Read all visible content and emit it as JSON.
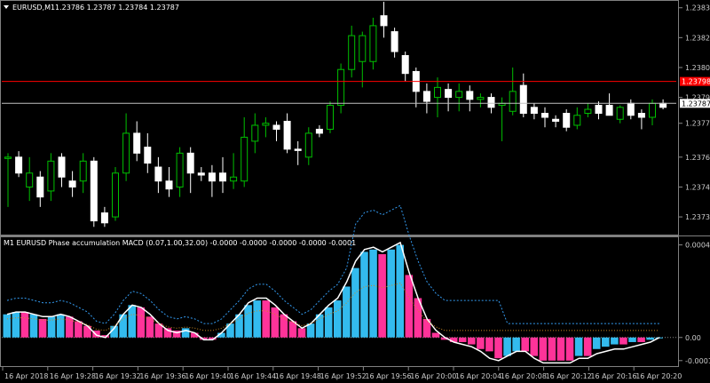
{
  "main_chart": {
    "symbol_header": "EURUSD,M1",
    "ohlc_header": "1.23786 1.23787 1.23784 1.23787",
    "price_ticks": [
      "1.23835",
      "1.23820",
      "1.23805",
      "1.23790",
      "1.23777",
      "1.23760",
      "1.23745",
      "1.23730"
    ],
    "red_line_label": "1.23798",
    "current_price_label": "1.23787",
    "colors": {
      "bull_stroke": "#00c000",
      "bull_fill": "#000000",
      "bear_fill": "#ffffff",
      "bear_stroke": "#ffffff",
      "red_line": "#ff0000",
      "price_line": "#c0c0c0",
      "grid": "#404040"
    }
  },
  "indicator": {
    "title": "M1 EURUSD Phase accumulation MACD (0.07,1.00,32.00) -0.0000 -0.0000 -0.0000 -0.0000 -0.0001",
    "y_ticks": [
      "0.0004",
      "0.00",
      "-0.0001"
    ],
    "colors": {
      "up": "#33bbee",
      "down": "#ff3399",
      "line": "#ffffff",
      "blue_dashed": "#3399ee",
      "orange_dotted": "#cc8822"
    }
  },
  "time_axis": {
    "labels": [
      "16 Apr 2018",
      "16 Apr 19:28",
      "16 Apr 19:32",
      "16 Apr 19:36",
      "16 Apr 19:40",
      "16 Apr 19:44",
      "16 Apr 19:48",
      "16 Apr 19:52",
      "16 Apr 19:56",
      "16 Apr 20:00",
      "16 Apr 20:04",
      "16 Apr 20:08",
      "16 Apr 20:12",
      "16 Apr 20:16",
      "16 Apr 20:20"
    ]
  },
  "chart_data": [
    {
      "type": "candlestick",
      "title": "EURUSD,M1",
      "ylim": [
        1.23722,
        1.23838
      ],
      "candles": [
        {
          "o": 1.2376,
          "h": 1.23762,
          "l": 1.23735,
          "c": 1.2376,
          "bull": true
        },
        {
          "o": 1.2376,
          "h": 1.23763,
          "l": 1.2375,
          "c": 1.23752,
          "bull": false
        },
        {
          "o": 1.23745,
          "h": 1.2376,
          "l": 1.23738,
          "c": 1.23752,
          "bull": true
        },
        {
          "o": 1.2375,
          "h": 1.23753,
          "l": 1.23735,
          "c": 1.2374,
          "bull": false
        },
        {
          "o": 1.23743,
          "h": 1.23762,
          "l": 1.23738,
          "c": 1.23758,
          "bull": true
        },
        {
          "o": 1.2376,
          "h": 1.23762,
          "l": 1.23745,
          "c": 1.2375,
          "bull": false
        },
        {
          "o": 1.23748,
          "h": 1.23753,
          "l": 1.2374,
          "c": 1.23745,
          "bull": false
        },
        {
          "o": 1.23748,
          "h": 1.23762,
          "l": 1.23742,
          "c": 1.23758,
          "bull": true
        },
        {
          "o": 1.23758,
          "h": 1.2376,
          "l": 1.23725,
          "c": 1.23728,
          "bull": false
        },
        {
          "o": 1.23727,
          "h": 1.23735,
          "l": 1.23725,
          "c": 1.23732,
          "bull": false
        },
        {
          "o": 1.2373,
          "h": 1.23755,
          "l": 1.23728,
          "c": 1.23752,
          "bull": true
        },
        {
          "o": 1.23752,
          "h": 1.23782,
          "l": 1.23748,
          "c": 1.23772,
          "bull": true
        },
        {
          "o": 1.23772,
          "h": 1.23778,
          "l": 1.23758,
          "c": 1.23762,
          "bull": false
        },
        {
          "o": 1.23765,
          "h": 1.23772,
          "l": 1.23752,
          "c": 1.23757,
          "bull": false
        },
        {
          "o": 1.23755,
          "h": 1.2376,
          "l": 1.23742,
          "c": 1.23748,
          "bull": false
        },
        {
          "o": 1.23748,
          "h": 1.23755,
          "l": 1.2374,
          "c": 1.23744,
          "bull": false
        },
        {
          "o": 1.23745,
          "h": 1.23765,
          "l": 1.2374,
          "c": 1.23762,
          "bull": true
        },
        {
          "o": 1.23762,
          "h": 1.23765,
          "l": 1.23742,
          "c": 1.23752,
          "bull": false
        },
        {
          "o": 1.23752,
          "h": 1.23755,
          "l": 1.23748,
          "c": 1.23751,
          "bull": false
        },
        {
          "o": 1.23752,
          "h": 1.23756,
          "l": 1.2374,
          "c": 1.23748,
          "bull": false
        },
        {
          "o": 1.23748,
          "h": 1.2376,
          "l": 1.23742,
          "c": 1.23752,
          "bull": false
        },
        {
          "o": 1.2375,
          "h": 1.23762,
          "l": 1.23744,
          "c": 1.23748,
          "bull": true
        },
        {
          "o": 1.23748,
          "h": 1.2378,
          "l": 1.23745,
          "c": 1.2377,
          "bull": true
        },
        {
          "o": 1.23768,
          "h": 1.23782,
          "l": 1.23762,
          "c": 1.23776,
          "bull": true
        },
        {
          "o": 1.23776,
          "h": 1.2378,
          "l": 1.2377,
          "c": 1.23777,
          "bull": true
        },
        {
          "o": 1.23776,
          "h": 1.23778,
          "l": 1.23768,
          "c": 1.23774,
          "bull": false
        },
        {
          "o": 1.23778,
          "h": 1.23782,
          "l": 1.23762,
          "c": 1.23764,
          "bull": false
        },
        {
          "o": 1.23764,
          "h": 1.23768,
          "l": 1.23756,
          "c": 1.23764,
          "bull": false
        },
        {
          "o": 1.2376,
          "h": 1.23775,
          "l": 1.23756,
          "c": 1.23772,
          "bull": true
        },
        {
          "o": 1.23772,
          "h": 1.23776,
          "l": 1.2377,
          "c": 1.23774,
          "bull": false
        },
        {
          "o": 1.23774,
          "h": 1.23788,
          "l": 1.23772,
          "c": 1.23786,
          "bull": true
        },
        {
          "o": 1.23786,
          "h": 1.23807,
          "l": 1.23782,
          "c": 1.23804,
          "bull": true
        },
        {
          "o": 1.23804,
          "h": 1.23826,
          "l": 1.238,
          "c": 1.23821,
          "bull": true
        },
        {
          "o": 1.23821,
          "h": 1.23823,
          "l": 1.23795,
          "c": 1.23808,
          "bull": true
        },
        {
          "o": 1.23808,
          "h": 1.2383,
          "l": 1.23804,
          "c": 1.23826,
          "bull": true
        },
        {
          "o": 1.23826,
          "h": 1.23838,
          "l": 1.2382,
          "c": 1.23831,
          "bull": false
        },
        {
          "o": 1.23823,
          "h": 1.23825,
          "l": 1.2381,
          "c": 1.23813,
          "bull": false
        },
        {
          "o": 1.23811,
          "h": 1.23813,
          "l": 1.23798,
          "c": 1.23802,
          "bull": false
        },
        {
          "o": 1.23803,
          "h": 1.23805,
          "l": 1.23785,
          "c": 1.23793,
          "bull": false
        },
        {
          "o": 1.23793,
          "h": 1.23797,
          "l": 1.23782,
          "c": 1.23788,
          "bull": false
        },
        {
          "o": 1.2379,
          "h": 1.238,
          "l": 1.2378,
          "c": 1.23795,
          "bull": true
        },
        {
          "o": 1.23794,
          "h": 1.23797,
          "l": 1.23783,
          "c": 1.2379,
          "bull": false
        },
        {
          "o": 1.2379,
          "h": 1.23797,
          "l": 1.23783,
          "c": 1.23793,
          "bull": true
        },
        {
          "o": 1.23793,
          "h": 1.23796,
          "l": 1.23783,
          "c": 1.23789,
          "bull": false
        },
        {
          "o": 1.23789,
          "h": 1.23792,
          "l": 1.23785,
          "c": 1.2379,
          "bull": true
        },
        {
          "o": 1.2379,
          "h": 1.23792,
          "l": 1.23782,
          "c": 1.23785,
          "bull": false
        },
        {
          "o": 1.23786,
          "h": 1.2379,
          "l": 1.23768,
          "c": 1.23787,
          "bull": true
        },
        {
          "o": 1.23783,
          "h": 1.23805,
          "l": 1.23781,
          "c": 1.23793,
          "bull": true
        },
        {
          "o": 1.23796,
          "h": 1.23802,
          "l": 1.2378,
          "c": 1.23782,
          "bull": false
        },
        {
          "o": 1.23785,
          "h": 1.23787,
          "l": 1.23779,
          "c": 1.23782,
          "bull": false
        },
        {
          "o": 1.23782,
          "h": 1.23785,
          "l": 1.23775,
          "c": 1.2378,
          "bull": false
        },
        {
          "o": 1.23779,
          "h": 1.23781,
          "l": 1.23775,
          "c": 1.23778,
          "bull": false
        },
        {
          "o": 1.23782,
          "h": 1.23784,
          "l": 1.23773,
          "c": 1.23775,
          "bull": false
        },
        {
          "o": 1.23776,
          "h": 1.23785,
          "l": 1.23774,
          "c": 1.23781,
          "bull": true
        },
        {
          "o": 1.23782,
          "h": 1.23787,
          "l": 1.2378,
          "c": 1.23784,
          "bull": true
        },
        {
          "o": 1.23782,
          "h": 1.23788,
          "l": 1.23779,
          "c": 1.23786,
          "bull": false
        },
        {
          "o": 1.23786,
          "h": 1.23792,
          "l": 1.23782,
          "c": 1.23781,
          "bull": false
        },
        {
          "o": 1.23779,
          "h": 1.23786,
          "l": 1.23777,
          "c": 1.23785,
          "bull": true
        },
        {
          "o": 1.23787,
          "h": 1.23789,
          "l": 1.23779,
          "c": 1.23781,
          "bull": false
        },
        {
          "o": 1.23782,
          "h": 1.23784,
          "l": 1.23774,
          "c": 1.2378,
          "bull": false
        },
        {
          "o": 1.2378,
          "h": 1.23789,
          "l": 1.23776,
          "c": 1.23787,
          "bull": true
        },
        {
          "o": 1.23785,
          "h": 1.23789,
          "l": 1.23784,
          "c": 1.23787,
          "bull": false
        }
      ]
    },
    {
      "type": "histogram",
      "title": "M1 EURUSD Phase accumulation MACD (0.07,1.00,32.00)",
      "ylim": [
        -0.00012,
        0.00041
      ],
      "values": [
        0.0001,
        0.00011,
        0.00011,
        0.0001,
        8e-05,
        9e-05,
        0.0001,
        9e-05,
        7e-05,
        5e-05,
        3e-05,
        1e-05,
        5e-05,
        0.0001,
        0.00014,
        0.00013,
        9e-05,
        6e-05,
        4e-05,
        3e-05,
        4e-05,
        2e-05,
        -1e-05,
        -1e-05,
        2e-05,
        6e-05,
        0.0001,
        0.00014,
        0.00016,
        0.00016,
        0.00013,
        0.0001,
        7e-05,
        4e-05,
        6e-05,
        0.0001,
        0.00013,
        0.00016,
        0.00022,
        0.0003,
        0.00037,
        0.00038,
        0.00036,
        0.00038,
        0.0004,
        0.00027,
        0.00017,
        8e-05,
        2e-05,
        -1e-05,
        -2e-05,
        -2e-05,
        -3e-05,
        -5e-05,
        -6e-05,
        -9e-05,
        -8e-05,
        -6e-05,
        -6e-05,
        -8e-05,
        -0.0001,
        -0.0001,
        -0.0001,
        -0.0001,
        -8e-05,
        -8e-05,
        -5e-05,
        -4e-05,
        -3e-05,
        -3e-05,
        -2e-05,
        -2e-05,
        -1e-05,
        0.0
      ],
      "up": [
        true,
        true,
        false,
        true,
        false,
        true,
        true,
        false,
        false,
        false,
        false,
        false,
        true,
        true,
        true,
        false,
        false,
        false,
        false,
        false,
        true,
        false,
        false,
        false,
        true,
        true,
        true,
        true,
        true,
        false,
        false,
        false,
        false,
        false,
        true,
        true,
        true,
        true,
        true,
        true,
        true,
        true,
        false,
        true,
        true,
        false,
        false,
        false,
        false,
        false,
        false,
        false,
        false,
        false,
        false,
        false,
        true,
        true,
        false,
        false,
        false,
        false,
        false,
        false,
        true,
        false,
        true,
        true,
        true,
        false,
        true,
        false,
        true,
        true
      ],
      "line": [
        0.0001,
        0.00011,
        0.00011,
        0.0001,
        9e-05,
        9e-05,
        0.0001,
        9e-05,
        7e-05,
        5e-05,
        1e-05,
        0.0,
        4e-05,
        0.0001,
        0.00014,
        0.00013,
        0.0001,
        6e-05,
        3e-05,
        2e-05,
        3e-05,
        2e-05,
        -1e-05,
        -1e-05,
        2e-05,
        6e-05,
        0.0001,
        0.00015,
        0.00017,
        0.00017,
        0.00014,
        0.0001,
        7e-05,
        4e-05,
        6e-05,
        0.0001,
        0.00014,
        0.00017,
        0.00024,
        0.00033,
        0.00038,
        0.00039,
        0.00037,
        0.00039,
        0.00041,
        0.00028,
        0.00017,
        8e-05,
        3e-05,
        0.0,
        -2e-05,
        -3e-05,
        -4e-05,
        -6e-05,
        -9e-05,
        -0.0001,
        -8e-05,
        -6e-05,
        -6e-05,
        -9e-05,
        -0.00011,
        -0.00011,
        -0.00011,
        -0.00011,
        -9e-05,
        -9e-05,
        -7e-05,
        -6e-05,
        -5e-05,
        -5e-05,
        -4e-05,
        -3e-05,
        -2e-05,
        0.0
      ]
    }
  ]
}
